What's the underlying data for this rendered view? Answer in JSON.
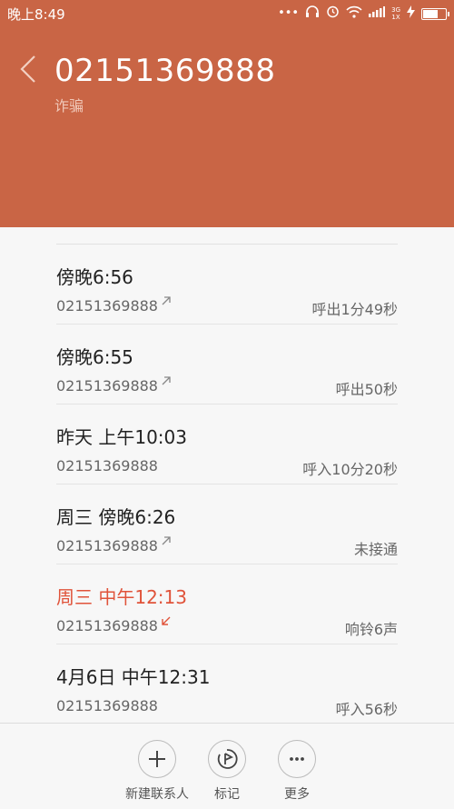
{
  "status_bar": {
    "time": "晚上8:49",
    "signal_badge_top": "3G",
    "signal_badge_bottom": "1X"
  },
  "header": {
    "phone_number": "02151369888",
    "tag": "诈骗",
    "background_color": "#c96545"
  },
  "calls": [
    {
      "title": "傍晚6:56",
      "number": "02151369888",
      "direction": "outgoing",
      "status": "呼出1分49秒"
    },
    {
      "title": "傍晚6:55",
      "number": "02151369888",
      "direction": "outgoing",
      "status": "呼出50秒"
    },
    {
      "title": "昨天 上午10:03",
      "number": "02151369888",
      "direction": "incoming",
      "status": "呼入10分20秒"
    },
    {
      "title": "周三 傍晚6:26",
      "number": "02151369888",
      "direction": "outgoing",
      "status": "未接通"
    },
    {
      "title": "周三 中午12:13",
      "number": "02151369888",
      "direction": "missed",
      "status": "响铃6声"
    },
    {
      "title": "4月6日 中午12:31",
      "number": "02151369888",
      "direction": "incoming",
      "status": "呼入56秒"
    }
  ],
  "actions": {
    "new_contact": "新建联系人",
    "mark": "标记",
    "more": "更多"
  },
  "colors": {
    "missed": "#e0533a"
  }
}
